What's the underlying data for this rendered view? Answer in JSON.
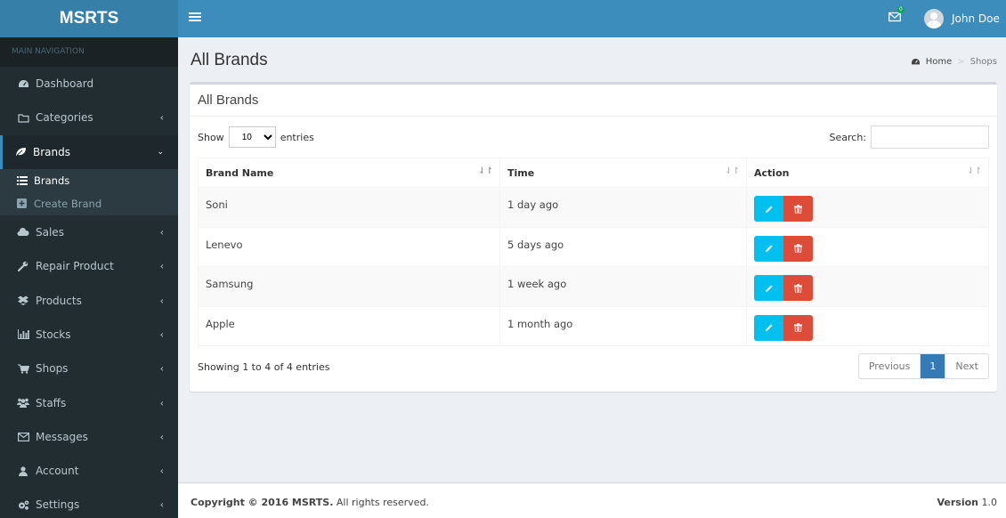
{
  "app": {
    "logo": "MSRTS"
  },
  "header": {
    "mail_badge": "0",
    "user_name": "John Doe"
  },
  "sidebar": {
    "section_label": "MAIN NAVIGATION",
    "items": [
      {
        "label": "Dashboard",
        "icon": "dashboard-icon"
      },
      {
        "label": "Categories",
        "icon": "folder-icon"
      },
      {
        "label": "Brands",
        "icon": "leaf-icon",
        "expanded": true
      },
      {
        "label": "Sales",
        "icon": "cloud-icon"
      },
      {
        "label": "Repair Product",
        "icon": "wrench-icon"
      },
      {
        "label": "Products",
        "icon": "dropbox-icon"
      },
      {
        "label": "Stocks",
        "icon": "bar-chart-icon"
      },
      {
        "label": "Shops",
        "icon": "cart-icon"
      },
      {
        "label": "Staffs",
        "icon": "users-icon"
      },
      {
        "label": "Messages",
        "icon": "envelope-icon"
      },
      {
        "label": "Account",
        "icon": "user-icon"
      },
      {
        "label": "Settings",
        "icon": "cogs-icon"
      }
    ],
    "brands_submenu": [
      {
        "label": "Brands",
        "icon": "list-icon",
        "active": true
      },
      {
        "label": "Create Brand",
        "icon": "plus-square-icon"
      }
    ]
  },
  "page": {
    "title": "All Brands",
    "breadcrumb": {
      "home": "Home",
      "current": "Shops"
    }
  },
  "box": {
    "title": "All Brands",
    "show_label": "Show",
    "entries_label": "entries",
    "page_length": "10",
    "search_label": "Search:",
    "search_value": "",
    "columns": [
      "Brand Name",
      "Time",
      "Action"
    ],
    "rows": [
      {
        "brand": "Soni",
        "time": "1 day ago"
      },
      {
        "brand": "Lenevo",
        "time": "5 days ago"
      },
      {
        "brand": "Samsung",
        "time": "1 week ago"
      },
      {
        "brand": "Apple",
        "time": "1 month ago"
      }
    ],
    "info": "Showing 1 to 4 of 4 entries",
    "pagination": {
      "previous": "Previous",
      "current": "1",
      "next": "Next"
    }
  },
  "footer": {
    "copyright_bold": "Copyright © 2016 MSRTS.",
    "copyright_rest": " All rights reserved.",
    "version_label": "Version",
    "version_value": " 1.0"
  },
  "colors": {
    "header": "#3c8dbc",
    "logo": "#367fa9",
    "sidebar": "#222d32",
    "edit": "#00c0ef",
    "delete": "#dd4b39",
    "page_active": "#337ab7",
    "badge": "#00a65a"
  }
}
